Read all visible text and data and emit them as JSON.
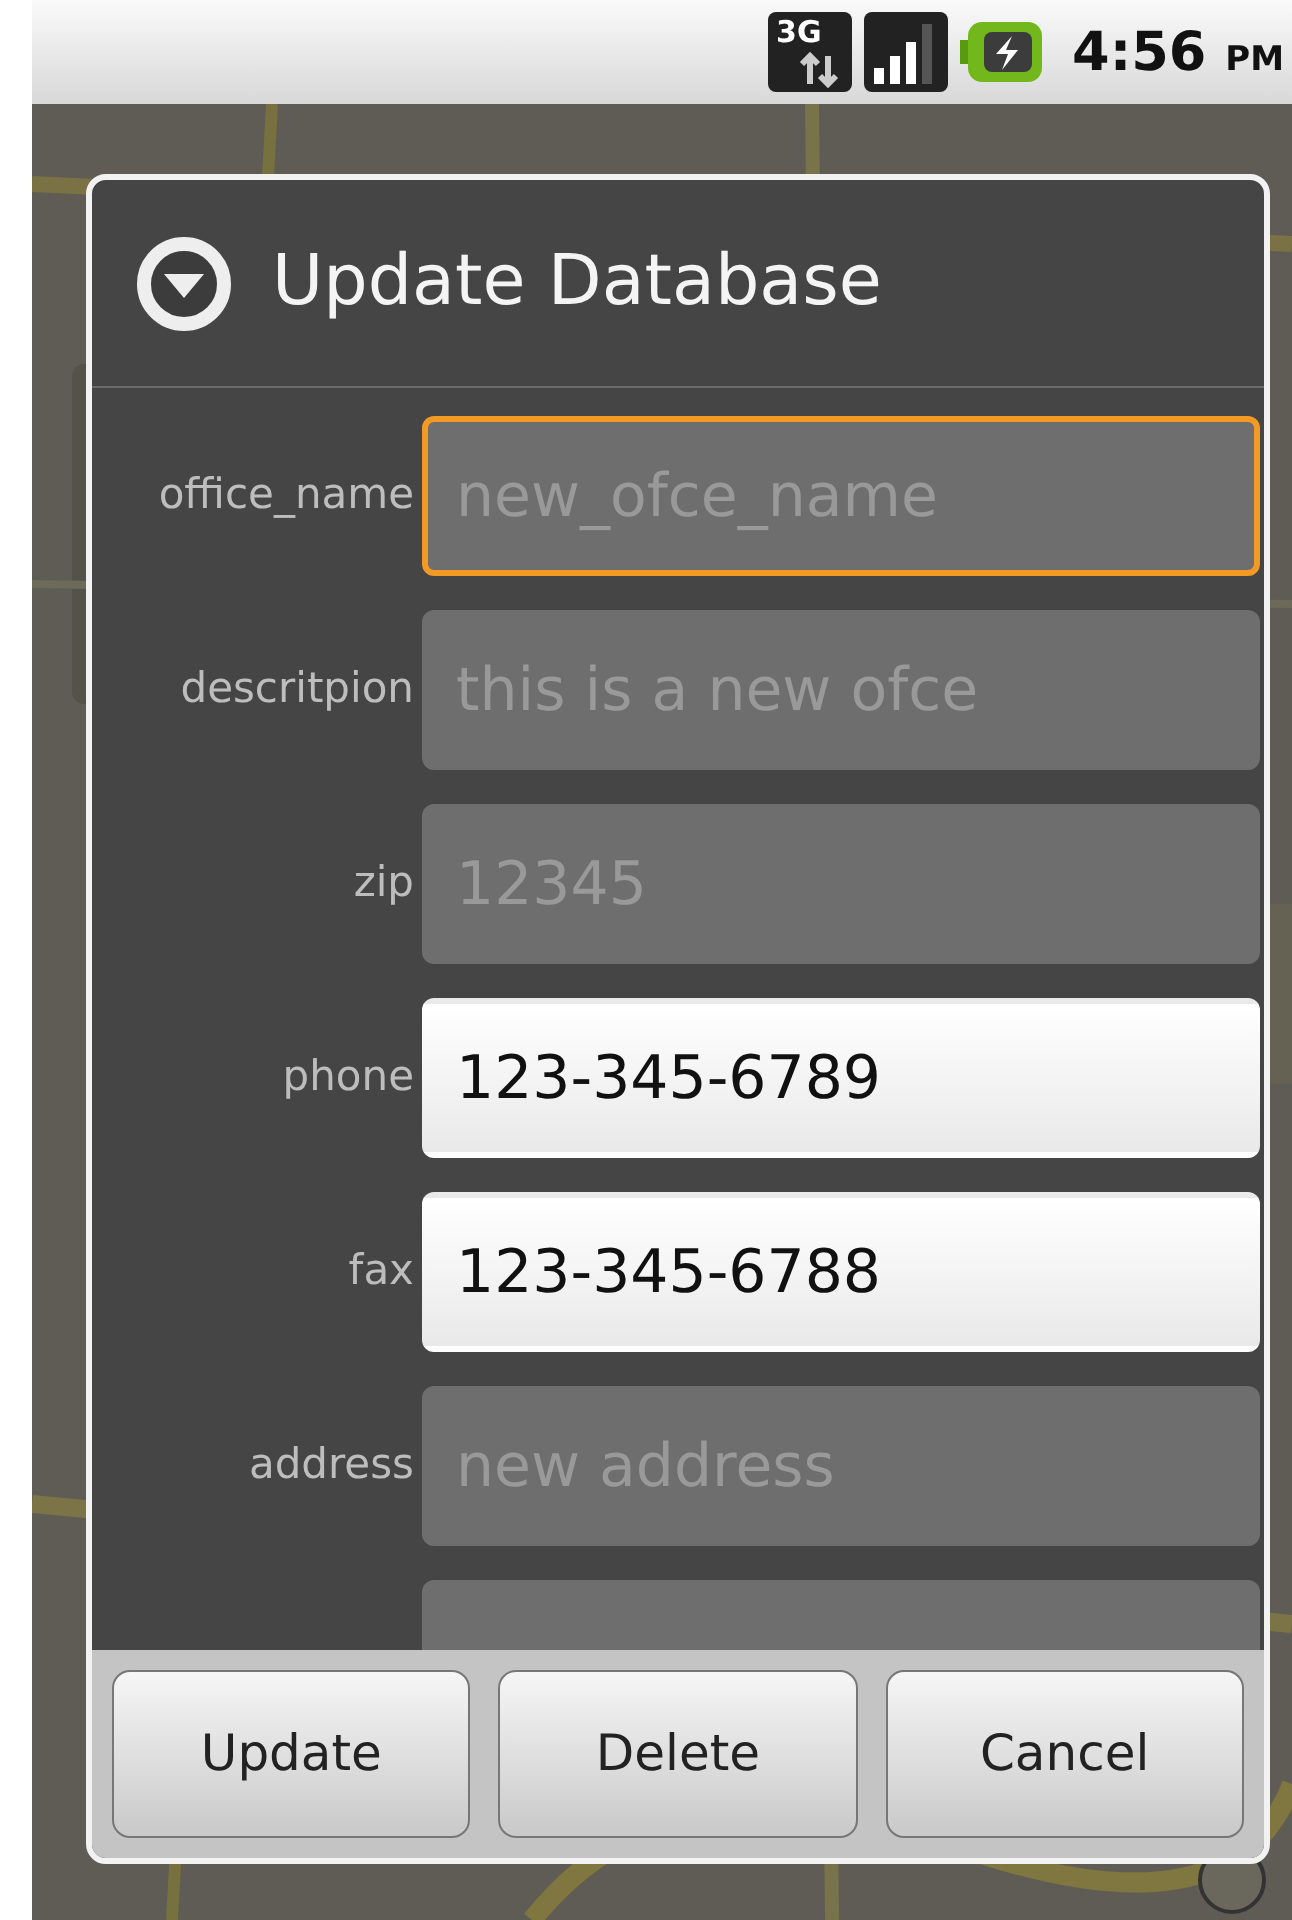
{
  "status_bar": {
    "network": "3G",
    "time": "4:56",
    "meridiem": "PM",
    "charging": true
  },
  "dialog": {
    "title": "Update Database",
    "fields": [
      {
        "label": "office_name",
        "placeholder": "new_ofce_name",
        "enabled": false,
        "focused": true
      },
      {
        "label": "descritpion",
        "placeholder": "this is a new ofce",
        "enabled": false,
        "focused": false
      },
      {
        "label": "zip",
        "placeholder": "12345",
        "enabled": false,
        "focused": false
      },
      {
        "label": "phone",
        "value": "123-345-6789",
        "enabled": true,
        "focused": false
      },
      {
        "label": "fax",
        "value": "123-345-6788",
        "enabled": true,
        "focused": false
      },
      {
        "label": "address",
        "placeholder": "new address",
        "enabled": false,
        "focused": false
      },
      {
        "enabled": false,
        "focused": false
      }
    ],
    "buttons": [
      "Update",
      "Delete",
      "Cancel"
    ]
  }
}
